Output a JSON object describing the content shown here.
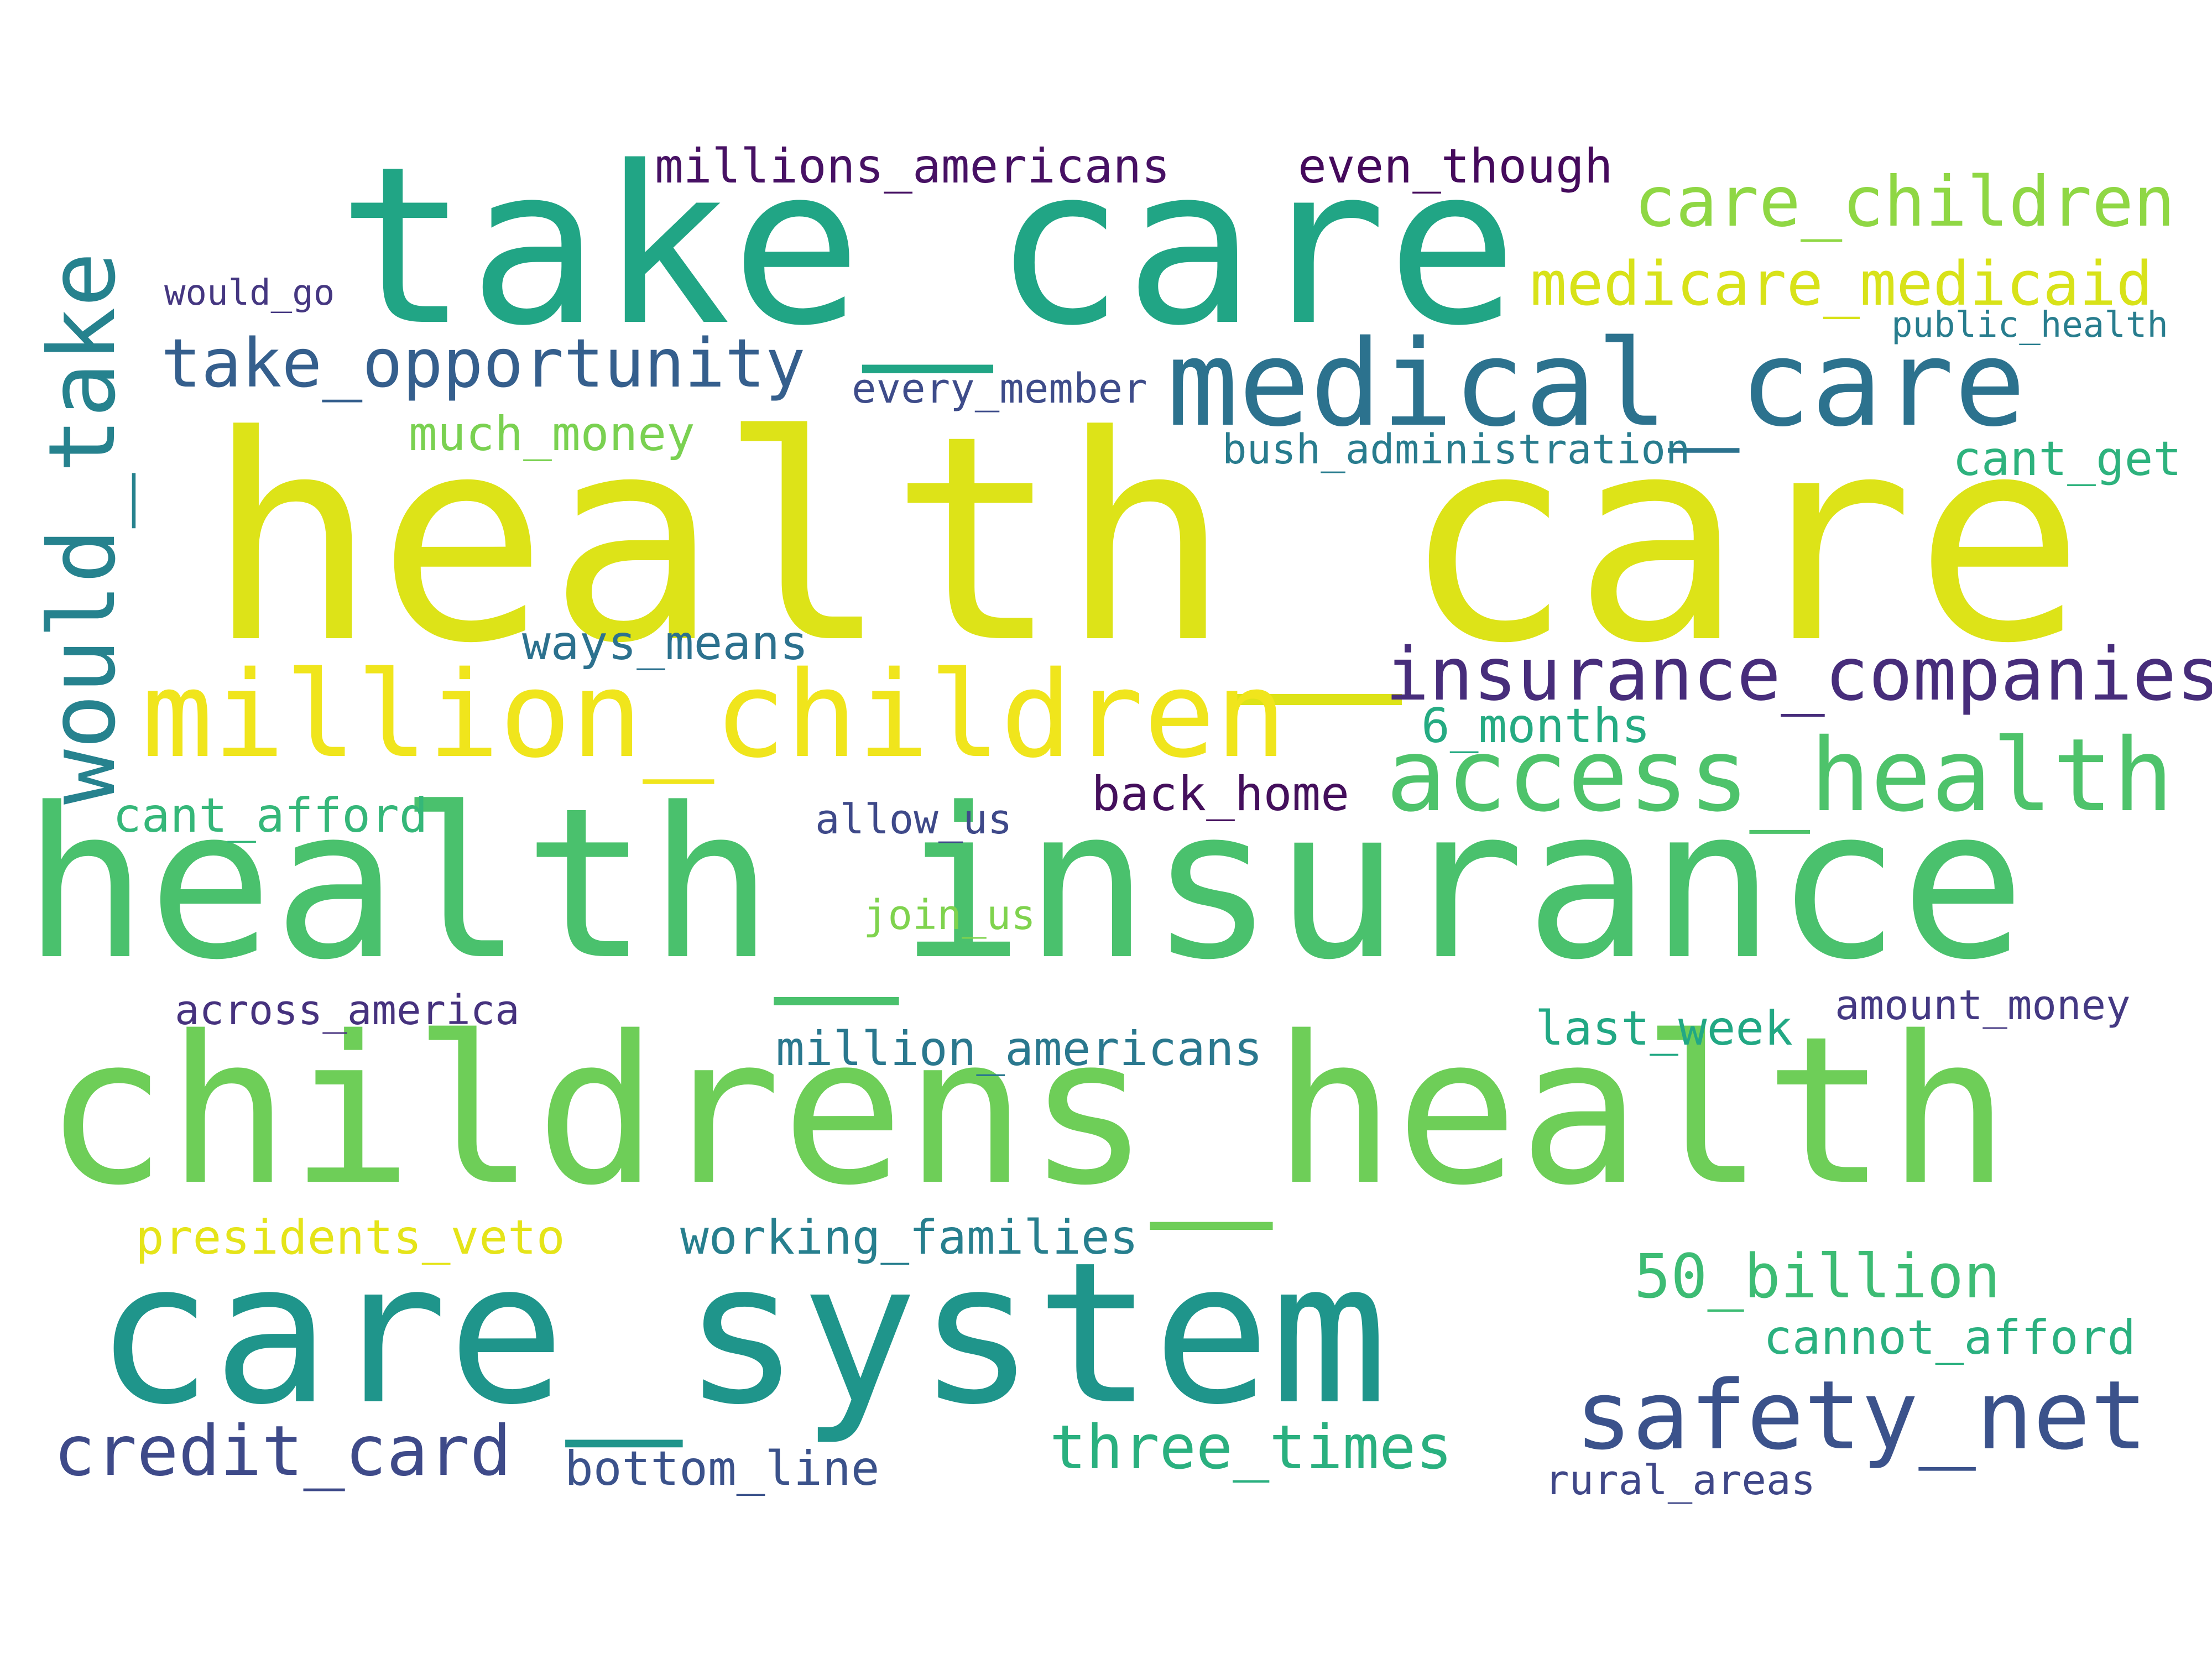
{
  "words": [
    {
      "id": "health_care",
      "text": "health_care",
      "color": "#dde318"
    },
    {
      "id": "health_insurance",
      "text": "health_insurance",
      "color": "#4ac16d"
    },
    {
      "id": "childrens_health",
      "text": "childrens_health",
      "color": "#6ece58"
    },
    {
      "id": "take_care",
      "text": "take_care",
      "color": "#21a585"
    },
    {
      "id": "care_system",
      "text": "care_system",
      "color": "#1f958b"
    },
    {
      "id": "million_children",
      "text": "million_children",
      "color": "#f0e51c"
    },
    {
      "id": "medical_care",
      "text": "medical_care",
      "color": "#2c728e"
    },
    {
      "id": "access_health",
      "text": "access_health",
      "color": "#4ec36b"
    },
    {
      "id": "would_take",
      "text": "would_take",
      "color": "#26828e"
    },
    {
      "id": "safety_net",
      "text": "safety_net",
      "color": "#3b528b"
    },
    {
      "id": "insurance_companies",
      "text": "insurance_companies",
      "color": "#472d7b"
    },
    {
      "id": "take_opportunity",
      "text": "take_opportunity",
      "color": "#355f8d"
    },
    {
      "id": "credit_card",
      "text": "credit_card",
      "color": "#3e4a89"
    },
    {
      "id": "care_children",
      "text": "care_children",
      "color": "#8fd744"
    },
    {
      "id": "medicare_medicaid",
      "text": "medicare_medicaid",
      "color": "#d8e219"
    },
    {
      "id": "three_times",
      "text": "three_times",
      "color": "#2ab07f"
    },
    {
      "id": "50_billion",
      "text": "50_billion",
      "color": "#3dbc74"
    },
    {
      "id": "million_americans",
      "text": "million_americans",
      "color": "#2a788e"
    },
    {
      "id": "working_families",
      "text": "working_families",
      "color": "#277f8e"
    },
    {
      "id": "presidents_veto",
      "text": "presidents_veto",
      "color": "#e5e419"
    },
    {
      "id": "back_home",
      "text": "back_home",
      "color": "#440f5c"
    },
    {
      "id": "much_money",
      "text": "much_money",
      "color": "#7ad151"
    },
    {
      "id": "millions_americans",
      "text": "millions_americans",
      "color": "#471164"
    },
    {
      "id": "last_week",
      "text": "last_week",
      "color": "#22a884"
    },
    {
      "id": "cant_afford",
      "text": "cant_afford",
      "color": "#35b779"
    },
    {
      "id": "ways_means",
      "text": "ways_means",
      "color": "#2c718e"
    },
    {
      "id": "bottom_line",
      "text": "bottom_line",
      "color": "#3b528b"
    },
    {
      "id": "cannot_afford",
      "text": "cannot_afford",
      "color": "#2ab07f"
    },
    {
      "id": "even_though",
      "text": "even_though",
      "color": "#450a5c"
    },
    {
      "id": "6_months",
      "text": "6_months",
      "color": "#25ab82"
    },
    {
      "id": "cant_get",
      "text": "cant_get",
      "color": "#2db27d"
    },
    {
      "id": "rural_areas",
      "text": "rural_areas",
      "color": "#3f4788"
    },
    {
      "id": "bush_administration",
      "text": "bush_administration",
      "color": "#287c8e"
    },
    {
      "id": "join_us",
      "text": "join_us",
      "color": "#7fd34e"
    },
    {
      "id": "amount_money",
      "text": "amount_money",
      "color": "#443983"
    },
    {
      "id": "across_america",
      "text": "across_america",
      "color": "#46327e"
    },
    {
      "id": "every_member",
      "text": "every_member",
      "color": "#3e4c8a"
    },
    {
      "id": "allow_us",
      "text": "allow_us",
      "color": "#3e4989"
    },
    {
      "id": "would_go",
      "text": "would_go",
      "color": "#453781"
    },
    {
      "id": "public_health",
      "text": "public_health",
      "color": "#287d8e"
    }
  ]
}
